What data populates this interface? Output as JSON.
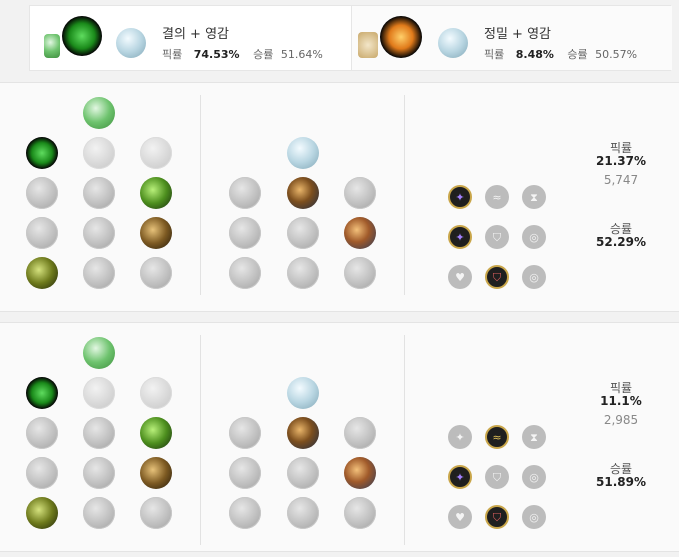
{
  "tabs": [
    {
      "title": "결의 + 영감",
      "pick_label": "픽률",
      "pick": "74.53%",
      "win_label": "승률",
      "win": "51.64%",
      "primary_icon": "resolve-tree-icon",
      "keystone_icon": "grasp-of-the-undying-icon",
      "secondary_icon": "inspiration-tree-icon"
    },
    {
      "title": "정밀 + 영감",
      "pick_label": "픽률",
      "pick": "8.48%",
      "win_label": "승률",
      "win": "50.57%",
      "primary_icon": "precision-tree-icon",
      "keystone_icon": "conqueror-icon",
      "secondary_icon": "inspiration-tree-icon"
    }
  ],
  "builds": [
    {
      "pick_label": "픽률",
      "pick": "21.37%",
      "games": "5,747",
      "win_label": "승률",
      "win": "52.29%"
    },
    {
      "pick_label": "픽률",
      "pick": "11.1%",
      "games": "2,985",
      "win_label": "승률",
      "win": "51.89%"
    }
  ],
  "colors": {
    "accent_gold": "#c9a64a",
    "resolve_green": "#2f9a2f",
    "precision_orange": "#e07a1a"
  }
}
